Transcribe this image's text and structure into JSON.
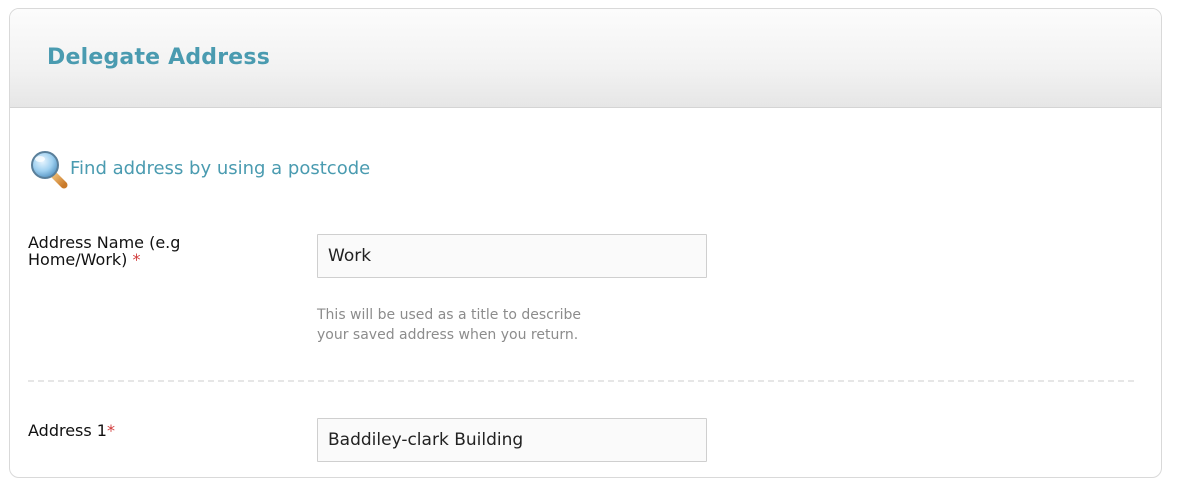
{
  "panel": {
    "title": "Delegate Address"
  },
  "find_address": {
    "icon": "magnifier-icon",
    "label": "Find address by using a postcode"
  },
  "fields": [
    {
      "label": "Address Name (e.g Home/Work)",
      "required_marker": "*",
      "value": "Work",
      "help_line1": "This will be used as a title to describe",
      "help_line2": "your saved address when you return."
    },
    {
      "label": "Address 1",
      "required_marker": "*",
      "value": "Baddiley-clark Building"
    }
  ],
  "colors": {
    "accent": "#4a9bb0",
    "required": "#d23b3b"
  }
}
